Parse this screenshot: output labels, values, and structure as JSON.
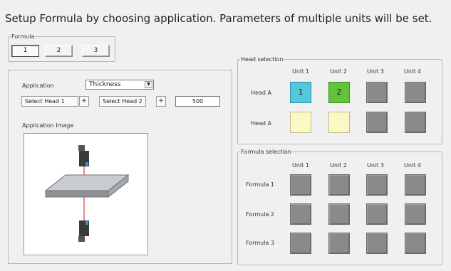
{
  "header": {
    "title": "Setup Formula by choosing application. Parameters of multiple units will be set."
  },
  "formula_group": {
    "legend": "Formula",
    "buttons": [
      "1",
      "2",
      "3"
    ],
    "selected_index": 0
  },
  "application": {
    "label": "Application",
    "selected": "Thickness",
    "dropdown_icon": "chevron-down-icon",
    "select_head_1": "Select Head 1",
    "select_head_2": "Select Head 2",
    "plus_1": "+",
    "plus_2": "+",
    "value": "500",
    "image_label": "Application Image"
  },
  "head_selection": {
    "legend": "Head selection",
    "columns": [
      "Unit 1",
      "Unit 2",
      "Unit 3",
      "Unit 4"
    ],
    "rows": [
      {
        "label": "Head A",
        "cells": [
          {
            "text": "1",
            "color": "#56c6dc",
            "state": "cyan"
          },
          {
            "text": "2",
            "color": "#62c23a",
            "state": "green"
          },
          {
            "text": "",
            "color": "#8a8a8a",
            "state": "gray"
          },
          {
            "text": "",
            "color": "#8a8a8a",
            "state": "gray"
          }
        ]
      },
      {
        "label": "Head A",
        "cells": [
          {
            "text": "",
            "color": "#fbf8c4",
            "state": "cream"
          },
          {
            "text": "",
            "color": "#fbf8c4",
            "state": "cream"
          },
          {
            "text": "",
            "color": "#8a8a8a",
            "state": "gray"
          },
          {
            "text": "",
            "color": "#8a8a8a",
            "state": "gray"
          }
        ]
      }
    ]
  },
  "formula_selection": {
    "legend": "Formula selection",
    "columns": [
      "Unit 1",
      "Unit 2",
      "Unit 3",
      "Unit 4"
    ],
    "rows": [
      {
        "label": "Formula 1",
        "cells": [
          "gray",
          "gray",
          "gray",
          "gray"
        ]
      },
      {
        "label": "Formula 2",
        "cells": [
          "gray",
          "gray",
          "gray",
          "gray"
        ]
      },
      {
        "label": "Formula 3",
        "cells": [
          "gray",
          "gray",
          "gray",
          "gray"
        ]
      }
    ]
  }
}
